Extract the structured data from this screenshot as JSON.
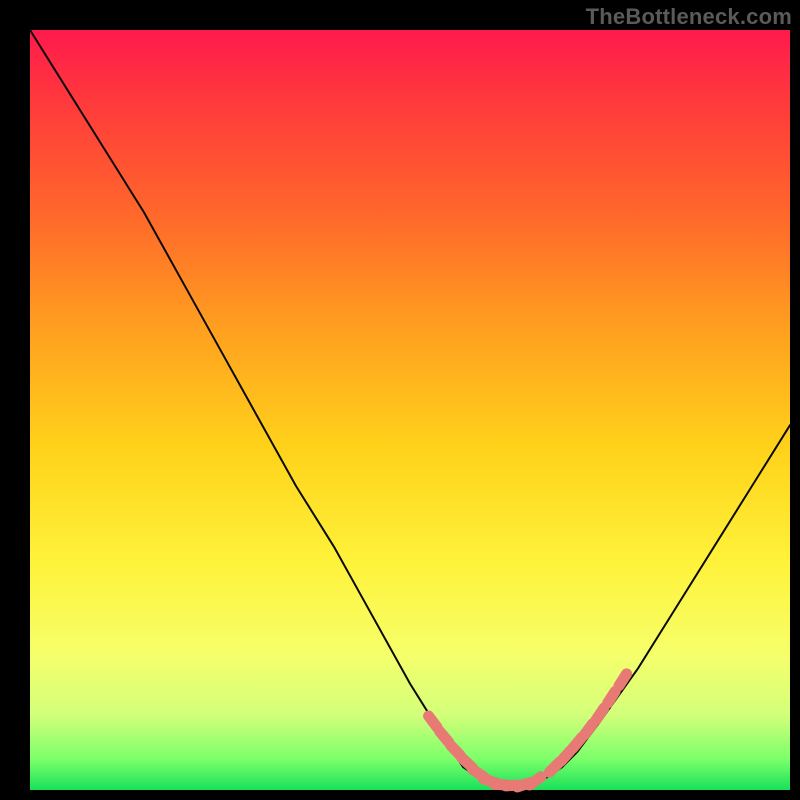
{
  "watermark": "TheBottleneck.com",
  "colors": {
    "page_bg": "#000000",
    "curve_stroke": "#0b0b0b",
    "dot_fill": "#e77a75",
    "gradient_stops": [
      "#ff1a4d",
      "#ff3b3b",
      "#ff6a2a",
      "#ffa21f",
      "#ffd21a",
      "#fff23a",
      "#f6ff6a",
      "#d4ff7a",
      "#7bff6a",
      "#18e05a"
    ]
  },
  "chart_data": {
    "type": "line",
    "title": "",
    "xlabel": "",
    "ylabel": "",
    "xlim": [
      0,
      100
    ],
    "ylim": [
      0,
      100
    ],
    "series": [
      {
        "name": "bottleneck-curve",
        "x": [
          0,
          5,
          10,
          15,
          20,
          25,
          30,
          35,
          40,
          45,
          50,
          55,
          57,
          60,
          62,
          65,
          67,
          70,
          72,
          75,
          80,
          85,
          90,
          95,
          100
        ],
        "y": [
          100,
          92,
          84,
          76,
          67,
          58,
          49,
          40,
          32,
          23,
          14,
          6,
          3,
          1,
          0.5,
          0.5,
          1,
          3,
          5,
          9,
          16,
          24,
          32,
          40,
          48
        ]
      }
    ],
    "markers": {
      "name": "optimal-range-dots",
      "x": [
        53,
        54.5,
        56,
        57.5,
        59,
        60.5,
        62,
        63.5,
        65,
        66.5,
        69,
        70.5,
        72,
        73.5,
        75,
        76.5,
        78
      ],
      "y": [
        9,
        7,
        5.2,
        3.6,
        2.2,
        1.2,
        0.7,
        0.6,
        0.7,
        1.2,
        3,
        4.5,
        6.2,
        8.0,
        10.0,
        12.2,
        14.5
      ]
    }
  }
}
